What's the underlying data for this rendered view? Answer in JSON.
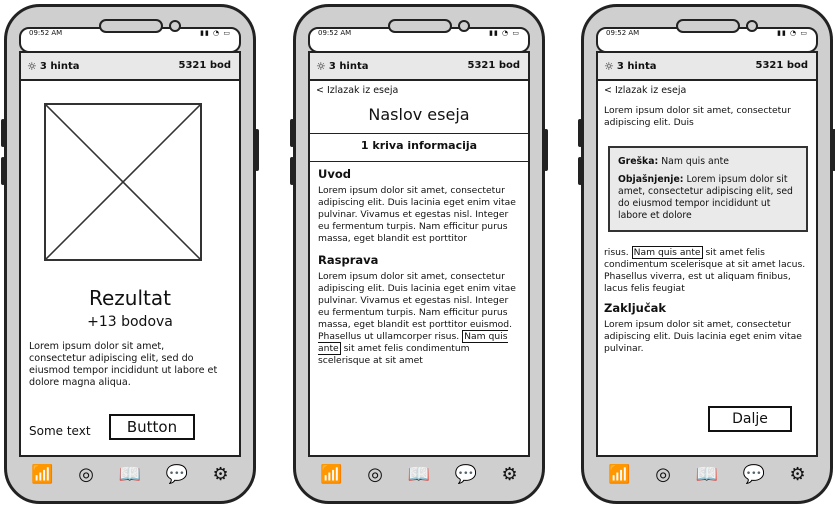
{
  "status_bar": {
    "time": "09:52 AM",
    "sys_icons": "▮▮ ◔ ▭"
  },
  "header": {
    "hint_label": "3 hinta",
    "points": "5321 bod"
  },
  "screen1": {
    "title": "Rezultat",
    "score": "+13 bodova",
    "text": "Lorem ipsum dolor sit amet, consectetur adipiscing elit, sed do eiusmod tempor incididunt ut labore et dolore magna aliqua.",
    "some_text": "Some text",
    "button": "Button"
  },
  "screen2": {
    "back": "< Izlazak iz eseja",
    "title": "Naslov eseja",
    "wrong_info": "1 kriva informacija",
    "section1_title": "Uvod",
    "section1_text": "Lorem ipsum dolor sit amet, consectetur adipiscing elit. Duis lacinia eget enim vitae pulvinar. Vivamus et egestas nisl. Integer eu fermentum turpis. Nam efficitur purus massa, eget blandit est porttitor",
    "section2_title": "Rasprava",
    "section2_text_a": "Lorem ipsum dolor sit amet, consectetur adipiscing elit. Duis lacinia eget enim vitae pulvinar. Vivamus et egestas nisl. Integer eu fermentum turpis. Nam efficitur purus massa, eget blandit est porttitor euismod. Phasellus ut ullamcorper risus.",
    "highlight": "Nam quis ante",
    "section2_text_b": "sit amet felis condimentum scelerisque at sit amet"
  },
  "screen3": {
    "back": "< Izlazak iz eseja",
    "intro_text": "Lorem ipsum dolor sit amet, consectetur adipiscing elit. Duis",
    "popup_error_label": "Greška:",
    "popup_error_value": "Nam quis ante",
    "popup_expl_label": "Objašnjenje:",
    "popup_expl_value": "Lorem ipsum dolor sit amet, consectetur adipiscing elit, sed do eiusmod tempor incididunt ut labore et dolore",
    "text_a": "risus.",
    "highlight": "Nam quis ante",
    "text_b": "sit amet felis condimentum scelerisque at sit amet lacus. Phasellus viverra, est ut aliquam finibus, lacus felis feugiat",
    "section_title": "Zaključak",
    "section_text": "Lorem ipsum dolor sit amet, consectetur adipiscing elit. Duis lacinia eget enim vitae pulvinar.",
    "next_button": "Dalje"
  },
  "nav_icons": [
    "stats-icon",
    "target-icon",
    "book-icon",
    "chat-icon",
    "settings-icon"
  ]
}
